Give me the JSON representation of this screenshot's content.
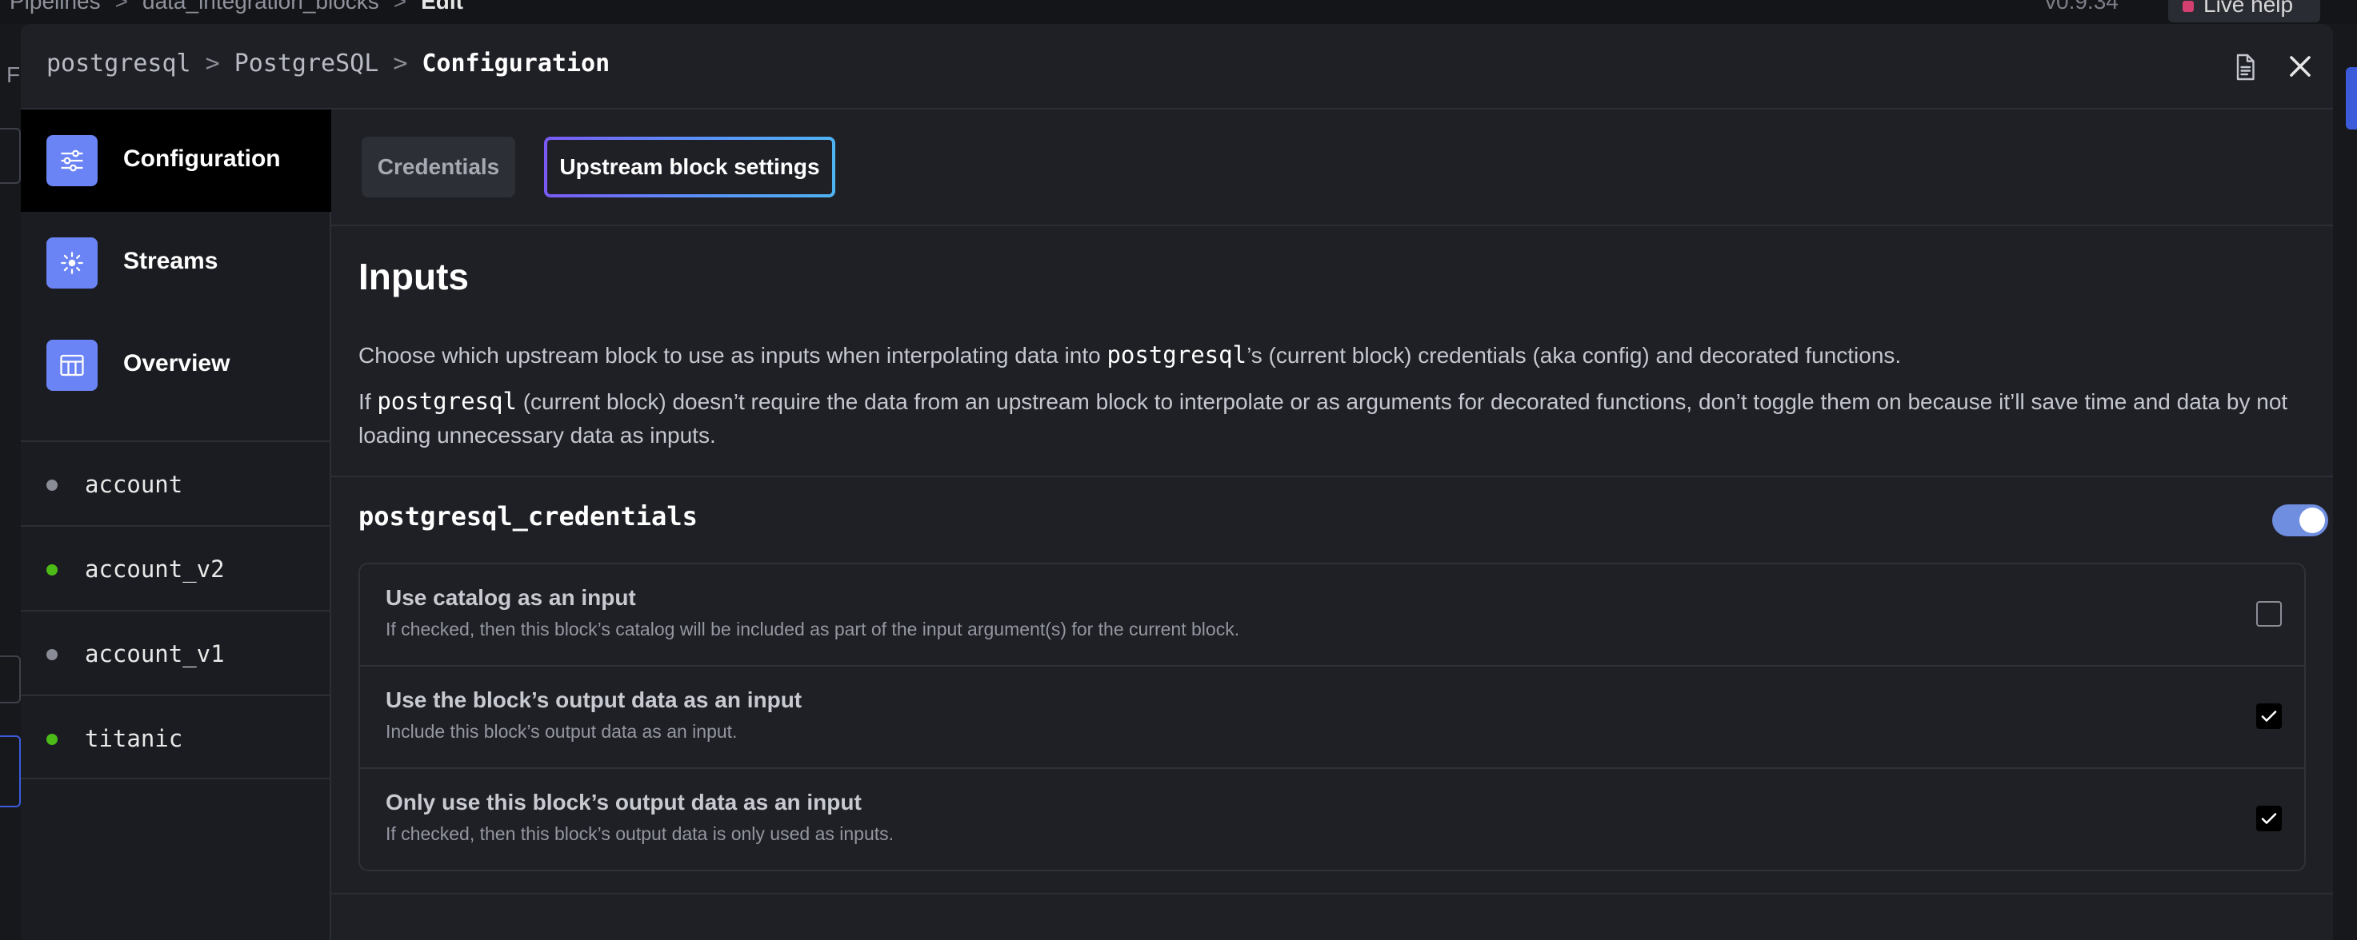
{
  "background": {
    "breadcrumb": [
      "Pipelines",
      "data_integration_blocks",
      "Edit"
    ],
    "version": "v0.9.34",
    "live_help": "Live help",
    "left_glyph": "F"
  },
  "modal": {
    "breadcrumb": {
      "block": "postgresql",
      "source": "PostgreSQL",
      "current": "Configuration"
    },
    "icons": {
      "doc": "document-icon",
      "close": "close-icon"
    }
  },
  "sidebar": {
    "nav": [
      {
        "label": "Configuration",
        "icon": "sliders-icon",
        "active": true
      },
      {
        "label": "Streams",
        "icon": "sparkle-icon",
        "active": false
      },
      {
        "label": "Overview",
        "icon": "table-icon",
        "active": false
      }
    ],
    "streams": [
      {
        "name": "account",
        "status_color": "#8a8d96"
      },
      {
        "name": "account_v2",
        "status_color": "#4cbb17"
      },
      {
        "name": "account_v1",
        "status_color": "#8a8d96"
      },
      {
        "name": "titanic",
        "status_color": "#4cbb17"
      }
    ]
  },
  "main": {
    "tabs": [
      {
        "label": "Credentials",
        "selected": false
      },
      {
        "label": "Upstream block settings",
        "selected": true
      }
    ],
    "title": "Inputs",
    "desc1": {
      "before": "Choose which upstream block to use as inputs when interpolating data into ",
      "code": "postgresql",
      "after": "’s (current block) credentials (aka config) and decorated functions."
    },
    "desc2": {
      "before": "If ",
      "code": "postgresql",
      "after": " (current block) doesn’t require the data from an upstream block to interpolate or as arguments for decorated functions, don’t toggle them on because it’ll save time and data by not loading unnecessary data as inputs."
    },
    "upstream_block": {
      "name": "postgresql_credentials",
      "enabled": true,
      "options": [
        {
          "title": "Use catalog as an input",
          "description": "If checked, then this block’s catalog will be included as part of the input argument(s) for the current block.",
          "checked": false
        },
        {
          "title": "Use the block’s output data as an input",
          "description": "Include this block’s output data as an input.",
          "checked": true
        },
        {
          "title": "Only use this block’s output data as an input",
          "description": "If checked, then this block’s output data is only used as inputs.",
          "checked": true
        }
      ]
    }
  },
  "colors": {
    "accent": "#6b84f5",
    "toggle_on": "#6f8ee0",
    "active_stream": "#4cbb17"
  }
}
